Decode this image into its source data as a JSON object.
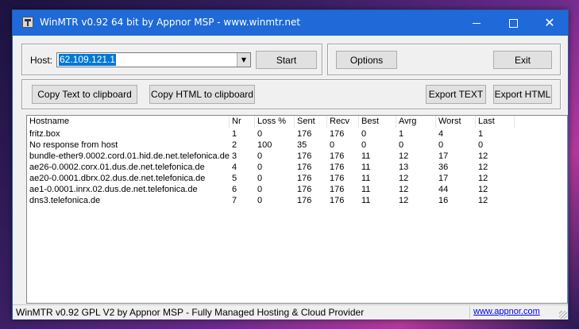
{
  "window": {
    "title": "WinMTR v0.92 64 bit by Appnor MSP - www.winmtr.net"
  },
  "host": {
    "label": "Host:",
    "value": "62.109.121.1"
  },
  "buttons": {
    "start": "Start",
    "options": "Options",
    "exit": "Exit",
    "copy_text": "Copy Text to clipboard",
    "copy_html": "Copy HTML to clipboard",
    "export_text": "Export TEXT",
    "export_html": "Export HTML"
  },
  "table": {
    "columns": [
      "Hostname",
      "Nr",
      "Loss %",
      "Sent",
      "Recv",
      "Best",
      "Avrg",
      "Worst",
      "Last"
    ],
    "rows": [
      [
        "fritz.box",
        "1",
        "0",
        "176",
        "176",
        "0",
        "1",
        "4",
        "1"
      ],
      [
        "No response from host",
        "2",
        "100",
        "35",
        "0",
        "0",
        "0",
        "0",
        "0"
      ],
      [
        "bundle-ether9.0002.cord.01.hid.de.net.telefonica.de",
        "3",
        "0",
        "176",
        "176",
        "11",
        "12",
        "17",
        "12"
      ],
      [
        "ae26-0.0002.corx.01.dus.de.net.telefonica.de",
        "4",
        "0",
        "176",
        "176",
        "11",
        "13",
        "36",
        "12"
      ],
      [
        "ae20-0.0001.dbrx.02.dus.de.net.telefonica.de",
        "5",
        "0",
        "176",
        "176",
        "11",
        "12",
        "17",
        "12"
      ],
      [
        "ae1-0.0001.inrx.02.dus.de.net.telefonica.de",
        "6",
        "0",
        "176",
        "176",
        "11",
        "12",
        "44",
        "12"
      ],
      [
        "dns3.telefonica.de",
        "7",
        "0",
        "176",
        "176",
        "11",
        "12",
        "16",
        "12"
      ]
    ]
  },
  "status": {
    "text": "WinMTR v0.92 GPL V2 by Appnor MSP - Fully Managed Hosting & Cloud Provider",
    "link": "www.appnor.com"
  },
  "colors": {
    "titlebar": "#1f6ad8",
    "selection": "#0078d7",
    "link": "#0000ee"
  }
}
